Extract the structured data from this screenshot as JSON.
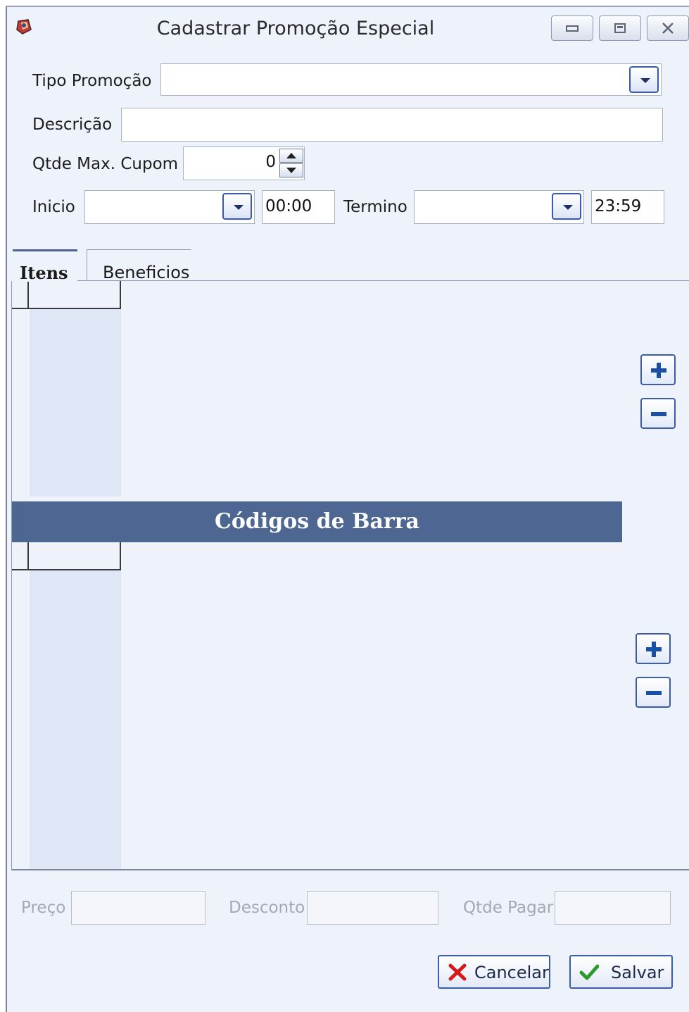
{
  "window": {
    "title": "Cadastrar Promoção Especial",
    "controls": {
      "minimize_icon": "minimize-icon",
      "maximize_icon": "maximize-icon",
      "close_icon": "close-icon"
    }
  },
  "form": {
    "tipo_promocao": {
      "label": "Tipo Promoção",
      "value": ""
    },
    "descricao": {
      "label": "Descrição",
      "value": ""
    },
    "qtde_max_cupom": {
      "label": "Qtde Max. Cupom",
      "value": "0"
    },
    "inicio": {
      "label": "Inicio",
      "date": "",
      "time": "00:00"
    },
    "termino": {
      "label": "Termino",
      "date": "",
      "time": "23:59"
    }
  },
  "tabs": [
    {
      "label": "Itens",
      "active": true
    },
    {
      "label": "Beneficios",
      "active": false
    }
  ],
  "sections": {
    "barcode_banner": "Códigos de Barra"
  },
  "footer_fields": {
    "preco": {
      "label": "Preço",
      "value": ""
    },
    "desconto": {
      "label": "Desconto",
      "value": ""
    },
    "qtde_pagar": {
      "label": "Qtde Pagar",
      "value": ""
    }
  },
  "buttons": {
    "cancel": "Cancelar",
    "save": "Salvar"
  },
  "colors": {
    "window_bg": "#eef2fb",
    "banner_bg": "#4d6692",
    "accent": "#3b5ca8",
    "cancel_icon": "#d61a1a",
    "save_icon": "#2a9a2a"
  }
}
